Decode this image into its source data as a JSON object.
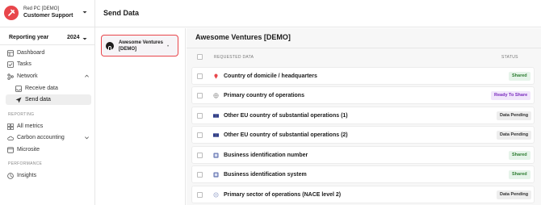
{
  "org": {
    "line1": "Red PC [DEMO]",
    "line2": "Customer Support"
  },
  "reporting": {
    "label": "Reporting year",
    "year": "2024"
  },
  "nav": {
    "dashboard": "Dashboard",
    "tasks": "Tasks",
    "network": "Network",
    "receive": "Receive data",
    "send": "Send data",
    "section_reporting": "REPORTING",
    "all_metrics": "All metrics",
    "carbon": "Carbon accounting",
    "microsite": "Microsite",
    "section_performance": "PERFORMANCE",
    "insights": "Insights"
  },
  "header": {
    "title": "Send Data"
  },
  "company": {
    "name_line1": "Awesome Ventures",
    "name_line2": "[DEMO]",
    "dot": "•"
  },
  "detail": {
    "title": "Awesome Ventures [DEMO]",
    "col_requested": "REQUESTED DATA",
    "col_status": "STATUS",
    "rows": [
      {
        "label": "Country of domicile / headquarters",
        "status": "Shared",
        "icon": "map-pin-icon"
      },
      {
        "label": "Primary country of operations",
        "status": "Ready To Share",
        "icon": "globe-icon"
      },
      {
        "label": "Other EU country of substantial operations (1)",
        "status": "Data Pending",
        "icon": "eu-flag-icon"
      },
      {
        "label": "Other EU country of substantial operations (2)",
        "status": "Data Pending",
        "icon": "eu-flag-icon"
      },
      {
        "label": "Business identification number",
        "status": "Shared",
        "icon": "id-icon"
      },
      {
        "label": "Business identification system",
        "status": "Shared",
        "icon": "id-icon"
      },
      {
        "label": "Primary sector of operations (NACE level 2)",
        "status": "Data Pending",
        "icon": "sector-icon"
      }
    ]
  },
  "colors": {
    "accent": "#e8464b",
    "shared_bg": "#e6f4ea",
    "shared_fg": "#2e7d32",
    "ready_bg": "#f1e6fb",
    "ready_fg": "#7b2cbf",
    "pending_bg": "#eeeeee"
  }
}
